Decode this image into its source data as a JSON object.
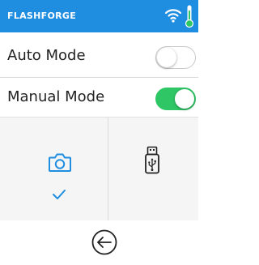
{
  "status_bar": {
    "brand": "FLASHFORGE",
    "wifi_icon": "wifi-icon",
    "thermometer_icon": "thermometer-icon",
    "bar_color": "#1f8de0"
  },
  "modes": {
    "auto": {
      "label": "Auto Mode",
      "enabled": false
    },
    "manual": {
      "label": "Manual Mode",
      "enabled": true
    },
    "toggle_on_color": "#2fc766"
  },
  "sources": {
    "camera": {
      "icon": "camera-icon",
      "selected": true,
      "check_icon": "check-icon"
    },
    "usb": {
      "icon": "usb-drive-icon",
      "selected": false
    },
    "accent_color": "#1f8de0"
  },
  "footer": {
    "back_icon": "back-arrow-icon"
  }
}
